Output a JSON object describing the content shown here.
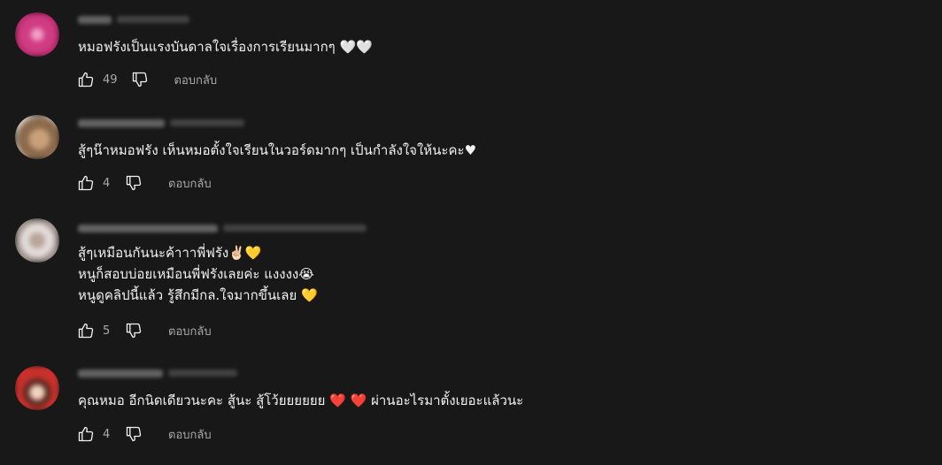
{
  "actions": {
    "reply_label": "ตอบกลับ"
  },
  "comments": [
    {
      "lines": [
        "หมอฟรังเป็นแรงบันดาลใจเรื่องการเรียนมากๆ 🤍🤍"
      ],
      "likes": "49"
    },
    {
      "lines": [
        "สู้ๆน๊าหมอฟรัง เห็นหมอตั้งใจเรียนในวอร์ดมากๆ เป็นกำลังใจให้นะคะ♥"
      ],
      "likes": "4"
    },
    {
      "lines": [
        "สู้ๆเหมือนกันนะค้าาาพี่ฟรัง✌🏻💛",
        "หนูก็สอบบ่อยเหมือนพี่ฟรังเลยค่ะ แงงงง😭",
        "หนูดูคลิปนี้แล้ว รู้สึกมีกล.ใจมากขึ้นเลย 💛"
      ],
      "likes": "5"
    },
    {
      "lines": [
        "คุณหมอ อีกนิดเดียวนะคะ สู้นะ สู้โว้ยยยยยย ❤️ ❤️ ผ่านอะไรมาตั้งเยอะแล้วนะ"
      ],
      "likes": "4"
    }
  ],
  "colors": {
    "background": "#181818",
    "text": "#f1f1f1",
    "secondary_text": "#aaaaaa"
  }
}
